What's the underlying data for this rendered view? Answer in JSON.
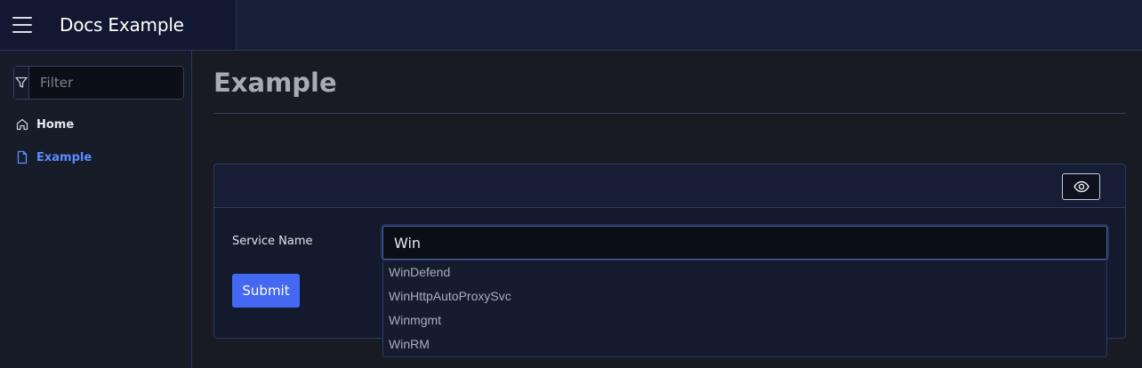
{
  "app": {
    "title": "Docs Example"
  },
  "sidebar": {
    "filter_placeholder": "Filter",
    "filter_icon": "filter-icon",
    "items": [
      {
        "label": "Home",
        "icon": "home-icon",
        "active": false
      },
      {
        "label": "Example",
        "icon": "document-icon",
        "active": true
      }
    ]
  },
  "main": {
    "title": "Example",
    "card": {
      "header_icon": "eye-icon",
      "form": {
        "field_label": "Service Name",
        "field_value": "Win",
        "submit_label": "Submit",
        "suggestions": [
          "WinDefend",
          "WinHttpAutoProxySvc",
          "Winmgmt",
          "WinRM"
        ]
      }
    }
  },
  "colors": {
    "accent": "#4468f2",
    "active_nav": "#5b8cff",
    "background": "#181b22",
    "topbar": "#182038"
  }
}
